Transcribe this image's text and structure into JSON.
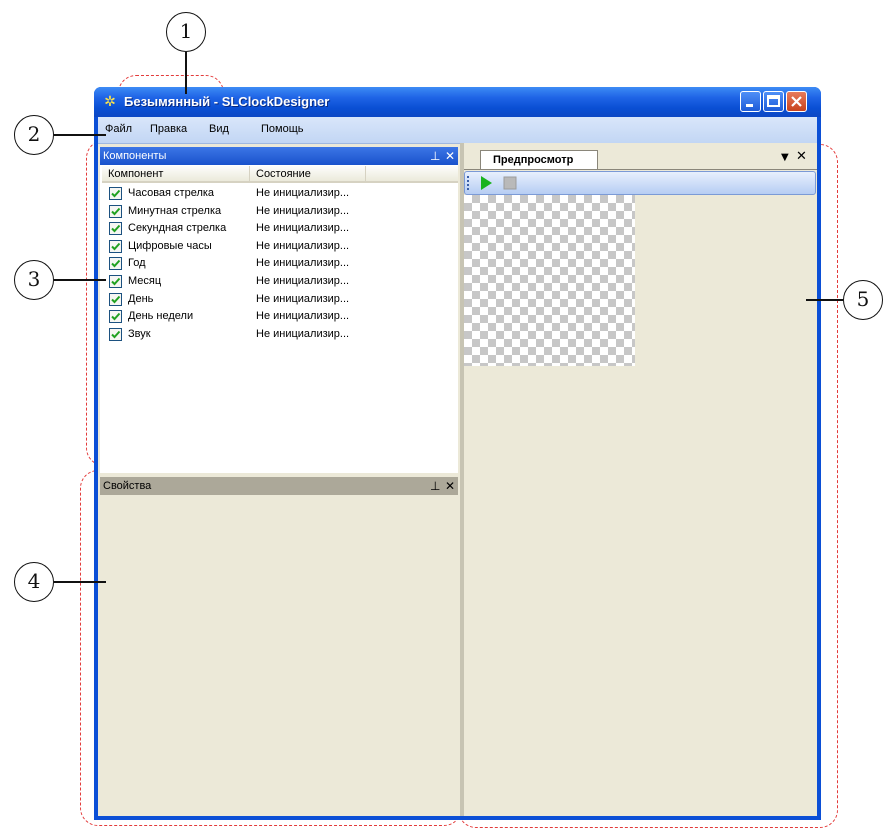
{
  "window": {
    "title": "Безымянный - SLClockDesigner",
    "menu": [
      "Файл",
      "Правка",
      "Вид",
      "Помощь"
    ]
  },
  "components_pane": {
    "title": "Компоненты",
    "pin_icon": "pin-icon",
    "close_icon": "close-icon",
    "columns": [
      "Компонент",
      "Состояние"
    ],
    "rows": [
      {
        "name": "Часовая стрелка",
        "state": "Не инициализир...",
        "checked": true
      },
      {
        "name": "Минутная стрелка",
        "state": "Не инициализир...",
        "checked": true
      },
      {
        "name": "Секундная стрелка",
        "state": "Не инициализир...",
        "checked": true
      },
      {
        "name": "Цифровые часы",
        "state": "Не инициализир...",
        "checked": true
      },
      {
        "name": "Год",
        "state": "Не инициализир...",
        "checked": true
      },
      {
        "name": "Месяц",
        "state": "Не инициализир...",
        "checked": true
      },
      {
        "name": "День",
        "state": "Не инициализир...",
        "checked": true
      },
      {
        "name": "День недели",
        "state": "Не инициализир...",
        "checked": true
      },
      {
        "name": "Звук",
        "state": "Не инициализир...",
        "checked": true
      }
    ]
  },
  "properties_pane": {
    "title": "Свойства"
  },
  "preview": {
    "tab_label": "Предпросмотр",
    "play_icon": "play-icon",
    "stop_icon": "stop-icon"
  },
  "callouts": [
    "1",
    "2",
    "3",
    "4",
    "5"
  ],
  "colors": {
    "titlebar": "#0a4fd4",
    "dash": "#e33b3b",
    "play": "#19b31f",
    "panel_bg": "#ece9d8"
  }
}
